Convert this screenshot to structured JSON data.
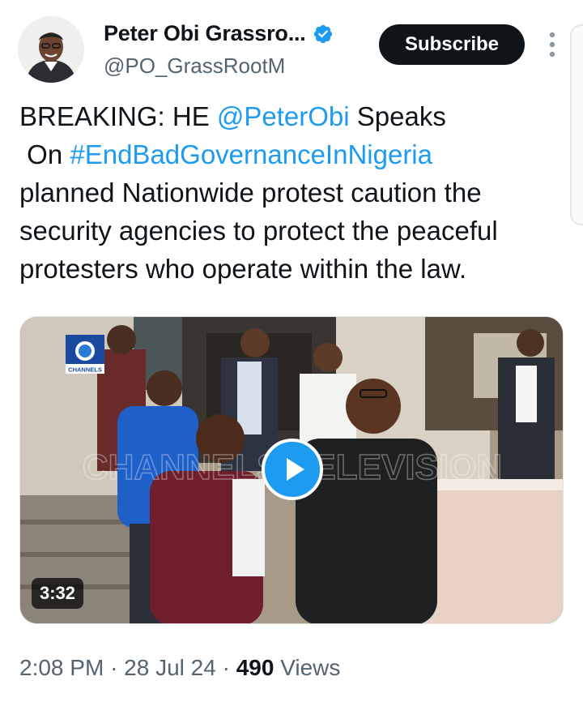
{
  "author": {
    "display_name": "Peter Obi Grassro...",
    "handle": "@PO_GrassRootM",
    "verified_icon": "verified-badge-icon"
  },
  "actions": {
    "subscribe_label": "Subscribe",
    "more_icon": "more-options-icon"
  },
  "tweet": {
    "lines": [
      {
        "before": "BREAKING: HE ",
        "link": "@PeterObi",
        "after": " Speaks"
      },
      {
        "before": " On ",
        "link": "#EndBadGovernanceInNigeria",
        "after": ""
      },
      {
        "before": "planned Nationwide protest caution the",
        "link": "",
        "after": ""
      },
      {
        "before": "security agencies to protect the peaceful",
        "link": "",
        "after": ""
      },
      {
        "before": "protesters who operate within the law.",
        "link": "",
        "after": ""
      }
    ]
  },
  "media": {
    "duration": "3:32",
    "play_icon": "play-icon",
    "channel_logo_text": "CHANNELS",
    "watermark_text": "CHANNELS TELEVISION"
  },
  "meta": {
    "time": "2:08 PM",
    "separator": "·",
    "date": "28 Jul 24",
    "views_count": "490",
    "views_label": "Views"
  },
  "colors": {
    "link": "#1d9bf0",
    "text": "#0f1419",
    "muted": "#536471",
    "button_bg": "#0f1419"
  }
}
